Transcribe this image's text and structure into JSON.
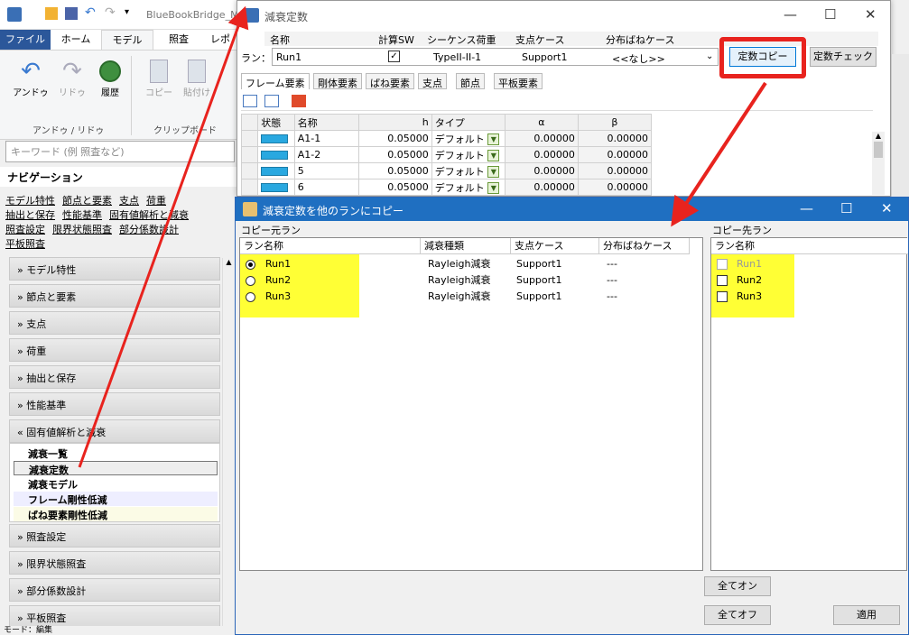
{
  "app": {
    "title": "BlueBookBridge_M",
    "tabs": [
      "ファイル",
      "ホーム",
      "モデル",
      "照査",
      "レポ"
    ],
    "ribbon": {
      "undo": "アンドゥ",
      "redo": "リドゥ",
      "history": "履歴",
      "copy": "コピー",
      "paste": "貼付け",
      "group_undo": "アンドゥ / リドゥ",
      "group_clip": "クリップボード"
    },
    "search_placeholder": "キーワード (例 照査など)",
    "nav_title": "ナビゲーション",
    "nav_links": [
      "モデル特性",
      "節点と要素",
      "支点",
      "荷重",
      "抽出と保存",
      "性能基準",
      "固有値解析と減衰",
      "照査設定",
      "限界状態照査",
      "部分係数設計",
      "平板照査"
    ],
    "sections_top": [
      "モデル特性",
      "節点と要素",
      "支点",
      "荷重",
      "抽出と保存",
      "性能基準",
      "固有値解析と減衰"
    ],
    "sub_items": [
      "減衰一覧",
      "減衰定数",
      "減衰モデル",
      "フレーム剛性低減",
      "ばね要素剛性低減"
    ],
    "sections_bottom": [
      "照査設定",
      "限界状態照査",
      "部分係数設計",
      "平板照査"
    ],
    "status": "モード：編集"
  },
  "dialog1": {
    "title": "減衰定数",
    "labels": {
      "name": "名称",
      "calc": "計算SW",
      "seq": "シーケンス荷重",
      "support": "支点ケース",
      "spring": "分布ばねケース",
      "run": "ラン："
    },
    "values": {
      "name": "Run1",
      "seq": "TypeII-II-1",
      "support": "Support1",
      "spring": "<<なし>>"
    },
    "btn_copy": "定数コピー",
    "btn_check": "定数チェック",
    "subtabs": [
      "フレーム要素",
      "剛体要素",
      "ばね要素",
      "支点",
      "節点",
      "平板要素"
    ],
    "grid_headers": [
      "状態",
      "名称",
      "h",
      "タイプ",
      "α",
      "β"
    ],
    "rows": [
      {
        "name": "A1-1",
        "h": "0.05000",
        "type": "デフォルト",
        "a": "0.00000",
        "b": "0.00000"
      },
      {
        "name": "A1-2",
        "h": "0.05000",
        "type": "デフォルト",
        "a": "0.00000",
        "b": "0.00000"
      },
      {
        "name": "5",
        "h": "0.05000",
        "type": "デフォルト",
        "a": "0.00000",
        "b": "0.00000"
      },
      {
        "name": "6",
        "h": "0.05000",
        "type": "デフォルト",
        "a": "0.00000",
        "b": "0.00000"
      }
    ]
  },
  "dialog2": {
    "title": "減衰定数を他のランにコピー",
    "source_label": "コピー元ラン",
    "dest_label": "コピー先ラン",
    "source_headers": [
      "ラン名称",
      "減衰種類",
      "支点ケース",
      "分布ばねケース"
    ],
    "dest_header": "ラン名称",
    "source_rows": [
      {
        "name": "Run1",
        "damp": "Rayleigh減衰",
        "support": "Support1",
        "spring": "---",
        "selected": true
      },
      {
        "name": "Run2",
        "damp": "Rayleigh減衰",
        "support": "Support1",
        "spring": "---",
        "selected": false
      },
      {
        "name": "Run3",
        "damp": "Rayleigh減衰",
        "support": "Support1",
        "spring": "---",
        "selected": false
      }
    ],
    "dest_rows": [
      "Run1",
      "Run2",
      "Run3"
    ],
    "btn_all_on": "全てオン",
    "btn_all_off": "全てオフ",
    "btn_apply": "適用"
  },
  "colors": {
    "accent": "#1f6fc1",
    "highlight": "#ffff35",
    "callout": "#e8231e"
  }
}
